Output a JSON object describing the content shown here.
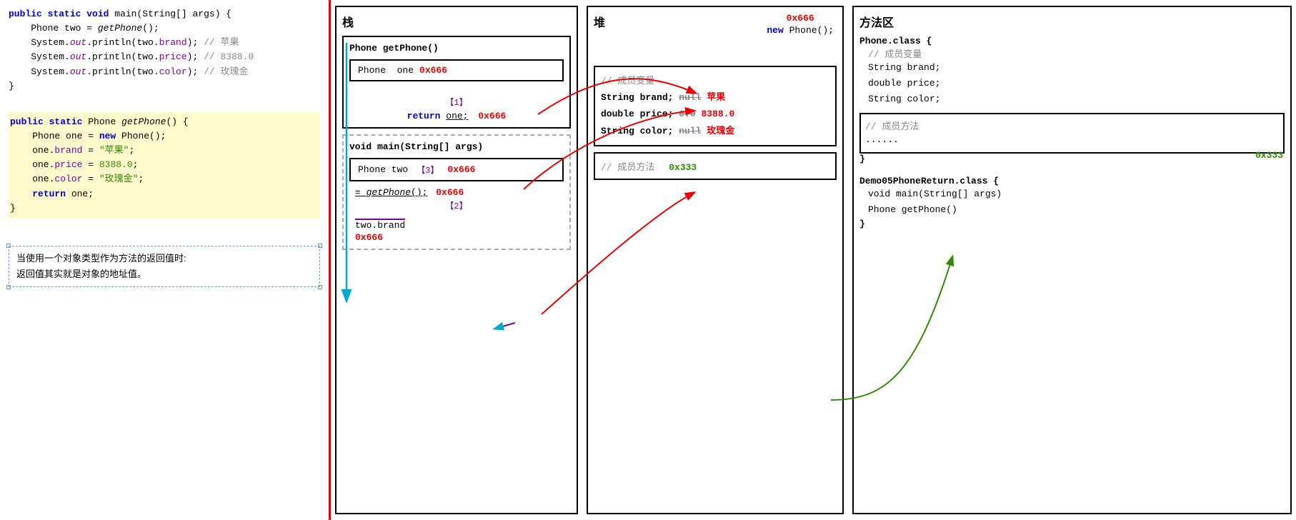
{
  "code_panel": {
    "main_method": [
      "public static void main(String[] args) {",
      "    Phone two = getPhone();",
      "    System.out.println(two.brand); // 苹果",
      "    System.out.println(two.price); // 8388.0",
      "    System.out.println(two.color); // 玫瑰金",
      "}"
    ],
    "get_phone_method": [
      "public static Phone getPhone() {",
      "    Phone one = new Phone();",
      "    one.brand = \"苹果\";",
      "    one.price = 8388.0;",
      "    one.color = \"玫瑰金\";",
      "    return one;",
      "}"
    ],
    "note": {
      "line1": "当使用一个对象类型作为方法的返回值时:",
      "line2": "返回值其实就是对象的地址值。"
    }
  },
  "stack_panel": {
    "title": "栈",
    "get_phone_frame": {
      "title": "Phone getPhone()",
      "var_name": "Phone  one",
      "var_addr": "0x666",
      "bracket1": "【1】",
      "return_line": "return one;",
      "return_addr": "0x666"
    },
    "main_frame": {
      "title": "void main(String[] args)",
      "var_name": "Phone  two",
      "bracket3": "【3】",
      "var_addr": "0x666",
      "eq_line": "= getPhone();",
      "eq_addr": "0x666",
      "bracket2": "【2】",
      "field_label": "two.brand",
      "field_addr": "0x666"
    }
  },
  "heap_panel": {
    "title": "堆",
    "new_label": "new  Phone();",
    "addr_top": "0x666",
    "object": {
      "comment": "// 成员变量",
      "brand_label": "String brand;",
      "brand_old": "null",
      "brand_new": "苹果",
      "price_label": "double price;",
      "price_old": "0.0",
      "price_new": "8388.0",
      "color_label": "String color;",
      "color_old": "null",
      "color_new": "玫瑰金"
    },
    "method_area": {
      "comment": "// 成员方法",
      "addr": "0x333"
    }
  },
  "method_panel": {
    "title": "方法区",
    "phone_class": {
      "name": "Phone.class {",
      "comment1": "// 成员变量",
      "fields": [
        "String brand;",
        "double price;",
        "String color;"
      ],
      "comment2": "// 成员方法",
      "method_placeholder": "......",
      "close": "}",
      "addr": "0x333"
    },
    "demo_class": {
      "name": "Demo05PhoneReturn.class {",
      "methods": [
        "void main(String[] args)",
        "Phone getPhone()"
      ],
      "close": "}"
    }
  },
  "arrows": {
    "colors": {
      "red": "#e00",
      "blue": "#00aacc",
      "purple": "#7b00a0",
      "green": "#2e8b00"
    }
  }
}
